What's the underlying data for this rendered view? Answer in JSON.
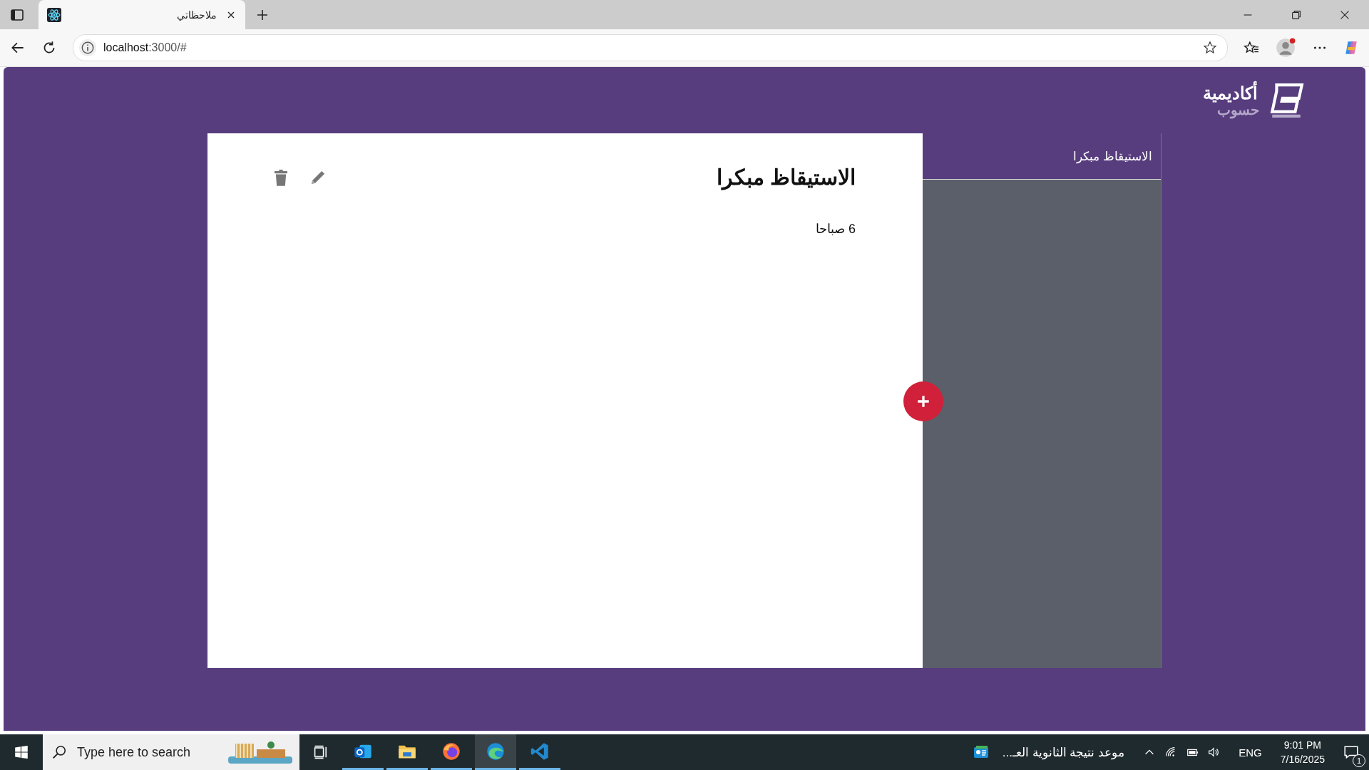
{
  "browser": {
    "tab_title": "ملاحظاتي",
    "url_host": "localhost",
    "url_rest": ":3000/#"
  },
  "logo": {
    "line_1": "أكاديمية",
    "line_2": "حسوب"
  },
  "notes": [
    {
      "title": "الاستيقاظ مبكرا",
      "selected": true
    }
  ],
  "note": {
    "title": "الاستيقاظ مبكرا",
    "body": "6 صباحا"
  },
  "taskbar": {
    "search": {
      "placeholder": "Type here to search"
    },
    "apps": [
      {
        "kind": "outlook",
        "selected": false
      },
      {
        "kind": "explorer",
        "selected": false
      },
      {
        "kind": "firefox",
        "selected": false
      },
      {
        "kind": "edge",
        "selected": true
      },
      {
        "kind": "vscode",
        "selected": false
      }
    ],
    "news": "موعد نتيجة الثانوية العـ...",
    "language": "ENG",
    "time": "9:01 PM",
    "date": "7/16/2025",
    "notifications": "1"
  }
}
